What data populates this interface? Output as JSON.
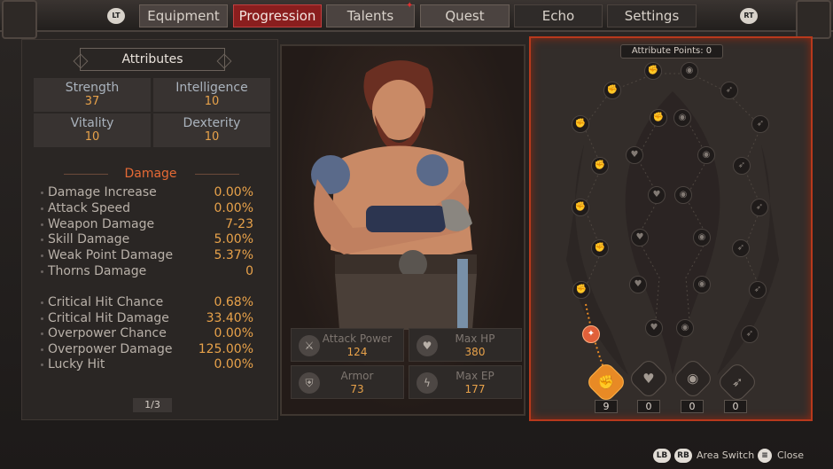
{
  "nav": {
    "left_trigger": "LT",
    "right_trigger": "RT",
    "tabs": [
      {
        "label": "Equipment"
      },
      {
        "label": "Progression"
      },
      {
        "label": "Talents"
      },
      {
        "label": "Quest"
      },
      {
        "label": "Echo"
      },
      {
        "label": "Settings"
      }
    ],
    "active_tab": "Progression",
    "notification_on": "Talents"
  },
  "attributes": {
    "title": "Attributes",
    "stats": [
      {
        "name": "Strength",
        "value": "37"
      },
      {
        "name": "Intelligence",
        "value": "10"
      },
      {
        "name": "Vitality",
        "value": "10"
      },
      {
        "name": "Dexterity",
        "value": "10"
      }
    ],
    "section_title": "Damage",
    "damage_rows": [
      {
        "label": "Damage Increase",
        "value": "0.00%"
      },
      {
        "label": "Attack Speed",
        "value": "0.00%"
      },
      {
        "label": "Weapon Damage",
        "value": "7-23"
      },
      {
        "label": "Skill Damage",
        "value": "5.00%"
      },
      {
        "label": "Weak Point Damage",
        "value": "5.37%"
      },
      {
        "label": "Thorns Damage",
        "value": "0"
      }
    ],
    "crit_rows": [
      {
        "label": "Critical Hit Chance",
        "value": "0.68%"
      },
      {
        "label": "Critical Hit Damage",
        "value": "33.40%"
      },
      {
        "label": "Overpower Chance",
        "value": "0.00%"
      },
      {
        "label": "Overpower Damage",
        "value": "125.00%"
      },
      {
        "label": "Lucky Hit",
        "value": "0.00%"
      }
    ],
    "page": "1/3"
  },
  "character_stats": [
    {
      "name": "Attack Power",
      "value": "124",
      "icon": "crossed-axes-icon"
    },
    {
      "name": "Max HP",
      "value": "380",
      "icon": "heart-icon"
    },
    {
      "name": "Armor",
      "value": "73",
      "icon": "armor-icon"
    },
    {
      "name": "Max EP",
      "value": "177",
      "icon": "lightning-icon"
    }
  ],
  "talent_tree": {
    "attribute_points_label": "Attribute Points: 0",
    "branches": [
      {
        "icon": "fist-icon",
        "count": "9",
        "active": true
      },
      {
        "icon": "heart-icon",
        "count": "0",
        "active": false
      },
      {
        "icon": "eye-icon",
        "count": "0",
        "active": false
      },
      {
        "icon": "wing-icon",
        "count": "0",
        "active": false
      }
    ]
  },
  "footer": {
    "lb": "LB",
    "rb": "RB",
    "area_switch": "Area Switch",
    "close": "Close"
  },
  "colors": {
    "accent": "#8a1e1e",
    "value": "#e8a24a",
    "section": "#e66a35",
    "tree_border": "#b8391c"
  }
}
